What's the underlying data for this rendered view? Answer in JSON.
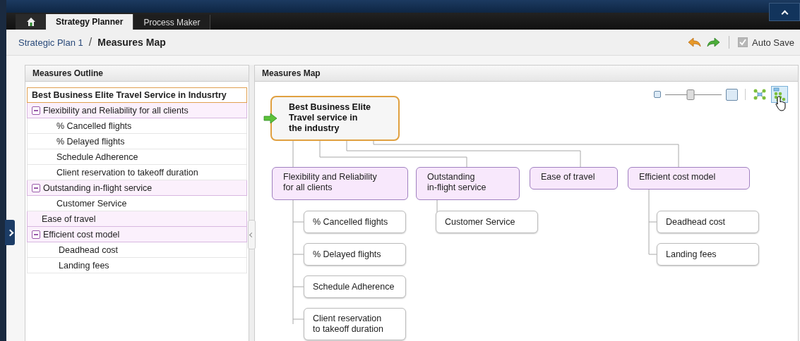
{
  "tabs": [
    {
      "label": "Strategy Planner",
      "selected": true
    },
    {
      "label": "Process Maker",
      "selected": false
    }
  ],
  "breadcrumb": {
    "parent": "Strategic Plan 1",
    "separator": "/",
    "current": "Measures Map"
  },
  "auto_save": {
    "label": "Auto Save",
    "checked": true
  },
  "outline": {
    "title": "Measures Outline",
    "root": {
      "label": "Best Business Elite Travel Service in Indusrtry",
      "selected": true
    },
    "items": [
      {
        "label": "Flexibility and Reliability for all clients",
        "expanded": true,
        "children": [
          {
            "label": "% Cancelled flights"
          },
          {
            "label": "% Delayed flights"
          },
          {
            "label": "Schedule Adherence"
          },
          {
            "label": "Client reservation to takeoff duration"
          }
        ]
      },
      {
        "label": "Outstanding in-flight service",
        "expanded": true,
        "children": [
          {
            "label": "Customer Service"
          }
        ]
      },
      {
        "label": "Ease of travel"
      },
      {
        "label": "Efficient cost model",
        "expanded": true,
        "children": [
          {
            "label": "Deadhead cost"
          },
          {
            "label": "Landing fees"
          }
        ]
      }
    ]
  },
  "map": {
    "title": "Measures Map",
    "zoom": {
      "level": 0.45
    },
    "root": {
      "label": "Best Business Elite\nTravel service in\nthe industry",
      "selected": true
    },
    "nodes": [
      {
        "label": "Flexibility and Reliability\nfor all clients",
        "children": [
          {
            "label": "% Cancelled flights"
          },
          {
            "label": "% Delayed flights"
          },
          {
            "label": "Schedule Adherence"
          },
          {
            "label": "Client reservation\nto takeoff duration"
          }
        ]
      },
      {
        "label": "Outstanding\nin-flight service",
        "children": [
          {
            "label": "Customer Service"
          }
        ]
      },
      {
        "label": "Ease of travel"
      },
      {
        "label": "Efficient cost model",
        "children": [
          {
            "label": "Deadhead cost"
          },
          {
            "label": "Landing fees"
          }
        ]
      }
    ]
  }
}
